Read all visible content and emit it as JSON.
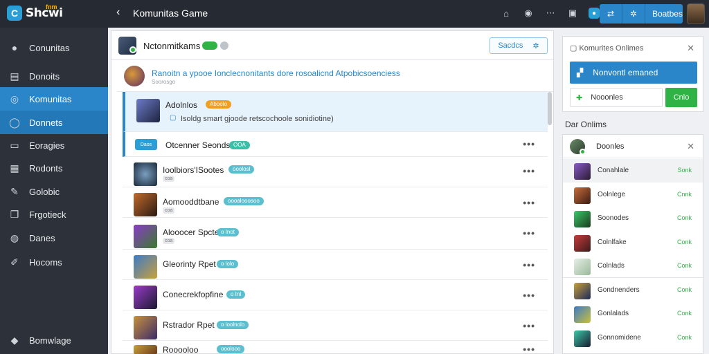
{
  "app": {
    "logo_text": "Shcwi",
    "logo_badge": "fnm",
    "window_title": "Komunitas Game",
    "top_button_label": "Boatbes"
  },
  "sidebar": {
    "items": [
      {
        "label": "Conunitas",
        "icon": "user-icon"
      },
      {
        "label": "Donoits",
        "icon": "doc-icon"
      },
      {
        "label": "Komunitas",
        "icon": "compass-icon"
      },
      {
        "label": "Donnets",
        "icon": "chat-icon"
      },
      {
        "label": "Eoragies",
        "icon": "folder-icon"
      },
      {
        "label": "Rodonts",
        "icon": "grid-icon"
      },
      {
        "label": "Golobic",
        "icon": "pencil-icon"
      },
      {
        "label": "Frgotieck",
        "icon": "copy-icon"
      },
      {
        "label": "Danes",
        "icon": "globe-icon"
      },
      {
        "label": "Hocoms",
        "icon": "brush-icon"
      }
    ],
    "footer": "Bomwlage"
  },
  "main": {
    "header_title": "Nctonmitkams",
    "search_label": "Sacdcs",
    "banner": {
      "title": "Ranoitn a ypooe Ionclecnonitants dore rosoalicnd Atpobicsoenciess",
      "subtitle": "Soorosgo"
    },
    "rows": [
      {
        "name": "Adolnlos",
        "tag": "Aboolo",
        "tag_color": "#f0a020",
        "detail": "Isoldg smart gjoode retscochoole sonidiotine)",
        "av": "linear-gradient(135deg,#6c7bc9,#1e2440)"
      },
      {
        "name": "Otcenner Seonds",
        "tag": "OOA",
        "tag_color": "#3bbfa8",
        "btn": "Daos"
      },
      {
        "name": "Ioolbiors'ISootes",
        "tag": "ooolosl",
        "tag_color": "#5bbfcf",
        "sub": "coa",
        "av": "radial-gradient(circle,#7a9ec0,#1a2a3a)"
      },
      {
        "name": "Aomooddtbane",
        "tag": "oooalooosoo",
        "tag_color": "#5bbfcf",
        "sub": "coa",
        "av": "linear-gradient(135deg,#c26b2b,#2a1a12)"
      },
      {
        "name": "Alooocer Spcte",
        "tag": "o Inot",
        "tag_color": "#5bbfcf",
        "sub": "coa",
        "av": "linear-gradient(135deg,#8a3bc9,#3a7a2a)"
      },
      {
        "name": "Gleorinty Rpet",
        "tag": "o lolo",
        "tag_color": "#5bbfcf",
        "sub": "",
        "av": "linear-gradient(135deg,#3b7ac9,#c9a03b)"
      },
      {
        "name": "Conecrekfopfine",
        "tag": "o Inl",
        "tag_color": "#5bbfcf",
        "sub": "",
        "av": "linear-gradient(135deg,#9b3bc9,#1a1a30)"
      },
      {
        "name": "Rstrador Rpet",
        "tag": "o loolnolo",
        "tag_color": "#5bbfcf",
        "sub": "",
        "av": "linear-gradient(135deg,#c9913b,#3a2a6a)"
      },
      {
        "name": "Rooooloo",
        "tag": "ooolooo",
        "tag_color": "#5bbfcf",
        "sub": "",
        "av": "linear-gradient(135deg,#c9a03b,#6a3a1a)"
      }
    ]
  },
  "right": {
    "panel_title": "Komurites Onlimes",
    "selected_label": "Nonvontl emaned",
    "input_label": "Nooonles",
    "go_label": "Cnlo",
    "section_title": "Dar Onlims",
    "top_user": "Doonles",
    "users": [
      {
        "name": "Conahlale",
        "status": "Sonk",
        "av": "linear-gradient(135deg,#8a5bc9,#2a1a30)"
      },
      {
        "name": "Oolnlege",
        "status": "Cnnk",
        "av": "linear-gradient(135deg,#c9703b,#3a1a12)"
      },
      {
        "name": "Soonodes",
        "status": "Conk",
        "av": "linear-gradient(135deg,#3bc96b,#1a3a1a)"
      },
      {
        "name": "Colnlfake",
        "status": "Conk",
        "av": "linear-gradient(135deg,#c93b3b,#3a1a1a)"
      },
      {
        "name": "Colnlads",
        "status": "Conk",
        "av": "linear-gradient(135deg,#e6efe6,#9ab89a)"
      },
      {
        "name": "Gondnenders",
        "status": "Conk",
        "av": "linear-gradient(135deg,#c9a03b,#1a2a5a)"
      },
      {
        "name": "Gonlalads",
        "status": "Conk",
        "av": "linear-gradient(135deg,#3b7ac9,#c9c03b)"
      },
      {
        "name": "Gonnomidene",
        "status": "Conk",
        "av": "linear-gradient(135deg,#3bc9a8,#1a1a30)"
      }
    ]
  }
}
